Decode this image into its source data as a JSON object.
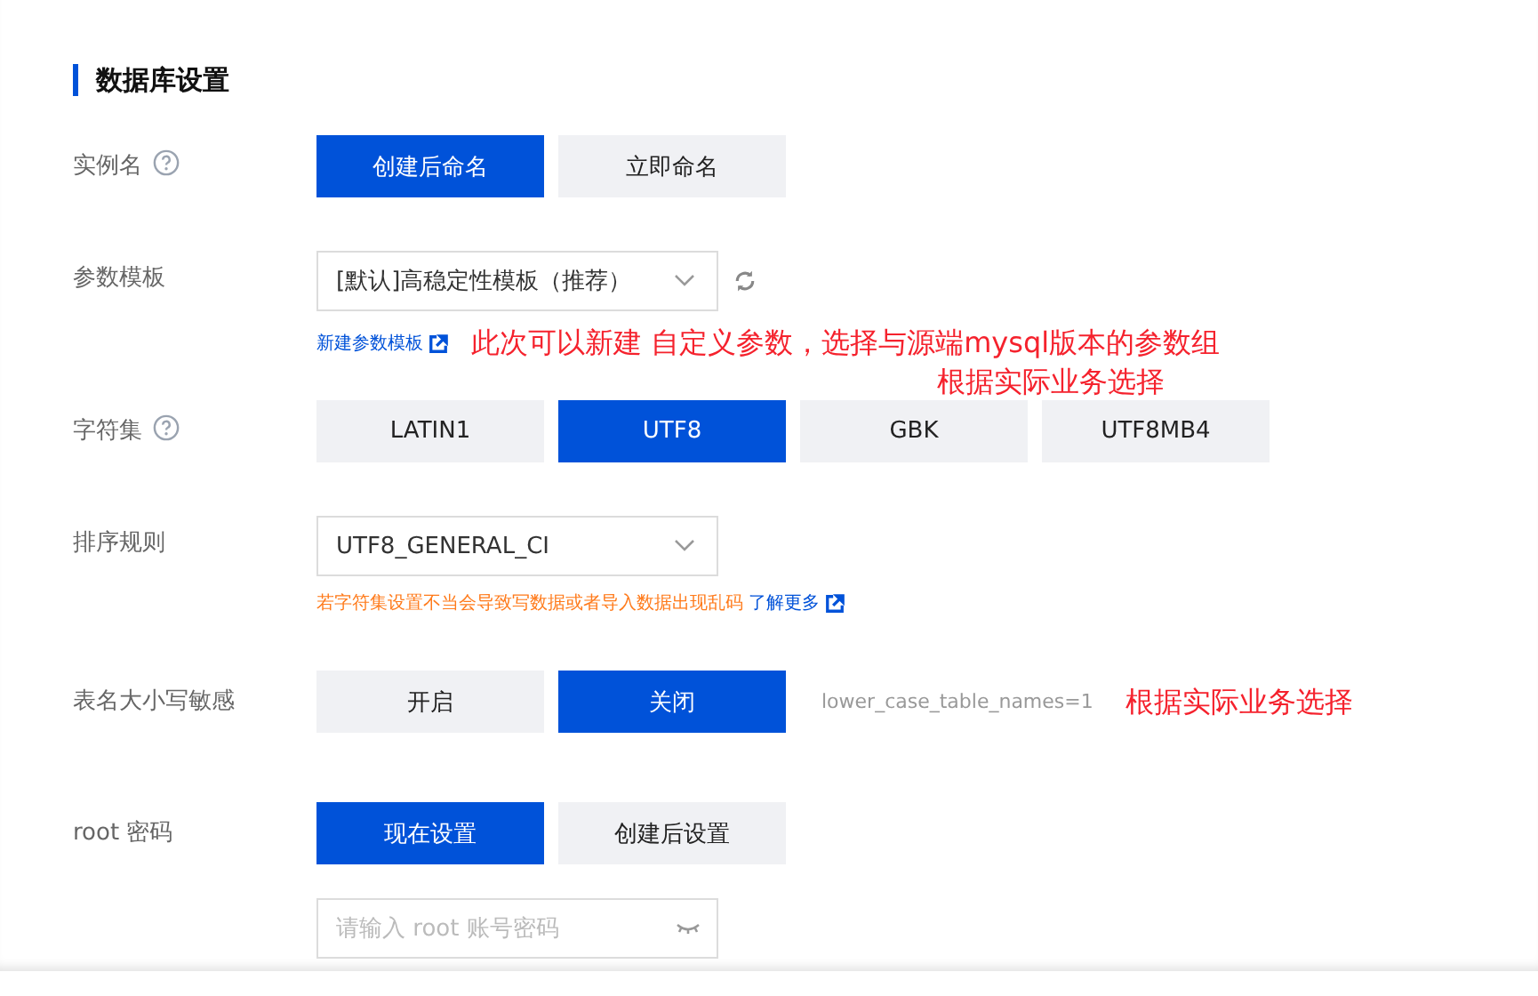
{
  "section_title": "数据库设置",
  "rows": [
    {
      "kind": "buttons",
      "label": "实例名",
      "help": true,
      "options": [
        {
          "label": "创建后命名",
          "selected": true
        },
        {
          "label": "立即命名",
          "selected": false
        }
      ]
    },
    {
      "kind": "select",
      "label": "参数模板",
      "value": "[默认]高稳定性模板（推荐）",
      "refresh": true,
      "link": "新建参数模板",
      "annotation": "此次可以新建 自定义参数，选择与源端mysql版本的参数组",
      "annotation_2": "根据实际业务选择"
    },
    {
      "kind": "buttons",
      "label": "字符集",
      "help": true,
      "options": [
        {
          "label": "LATIN1",
          "selected": false
        },
        {
          "label": "UTF8",
          "selected": true
        },
        {
          "label": "GBK",
          "selected": false
        },
        {
          "label": "UTF8MB4",
          "selected": false
        }
      ]
    },
    {
      "kind": "select",
      "label": "排序规则",
      "value": "UTF8_GENERAL_CI",
      "warning": "若字符集设置不当会导致写数据或者导入数据出现乱码",
      "link": "了解更多"
    },
    {
      "kind": "buttons",
      "label": "表名大小写敏感",
      "options": [
        {
          "label": "开启",
          "selected": false
        },
        {
          "label": "关闭",
          "selected": true
        }
      ],
      "note": "lower_case_table_names=1",
      "annotation": "根据实际业务选择"
    },
    {
      "kind": "buttons",
      "label": "root 密码",
      "options": [
        {
          "label": "现在设置",
          "selected": true
        },
        {
          "label": "创建后设置",
          "selected": false
        }
      ]
    },
    {
      "kind": "password",
      "placeholder": "请输入 root 账号密码"
    }
  ]
}
